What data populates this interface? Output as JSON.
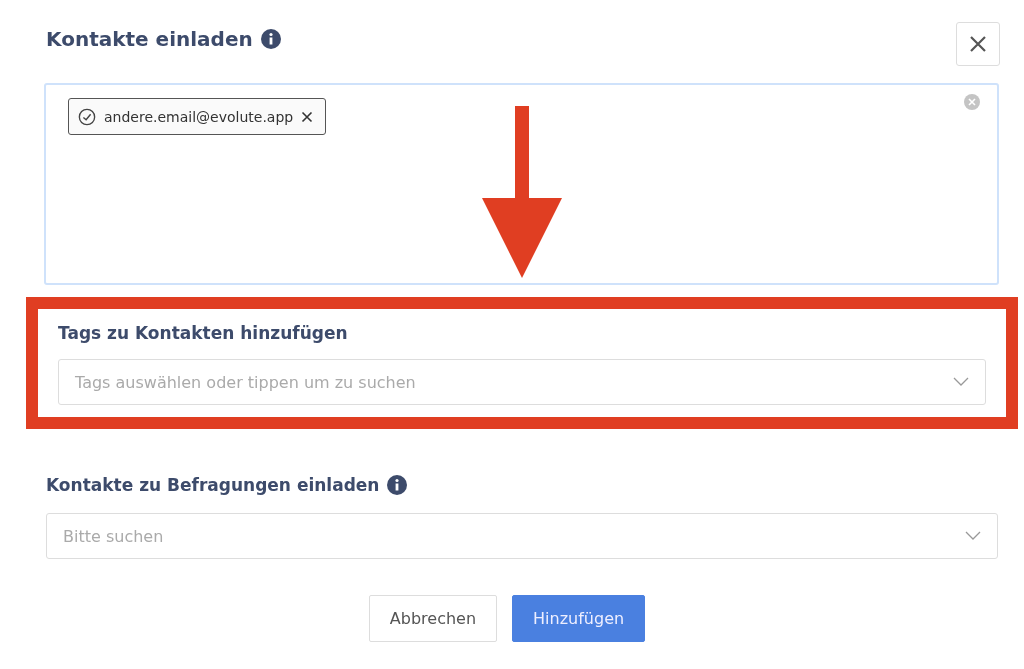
{
  "dialog": {
    "title": "Kontakte einladen",
    "info_icon": true
  },
  "email_field": {
    "chips": [
      {
        "label": "andere.email@evolute.app",
        "verified": true
      }
    ]
  },
  "tags_section": {
    "label": "Tags zu Kontakten hinzufügen",
    "placeholder": "Tags auswählen oder tippen um zu suchen",
    "highlighted": true
  },
  "surveys_section": {
    "label": "Kontakte zu Befragungen einladen",
    "info_icon": true,
    "placeholder": "Bitte suchen"
  },
  "annotation": {
    "kind": "arrow"
  },
  "buttons": [
    {
      "label": "Abbrechen",
      "kind": "secondary"
    },
    {
      "label": "Hinzufügen",
      "kind": "primary"
    }
  ]
}
